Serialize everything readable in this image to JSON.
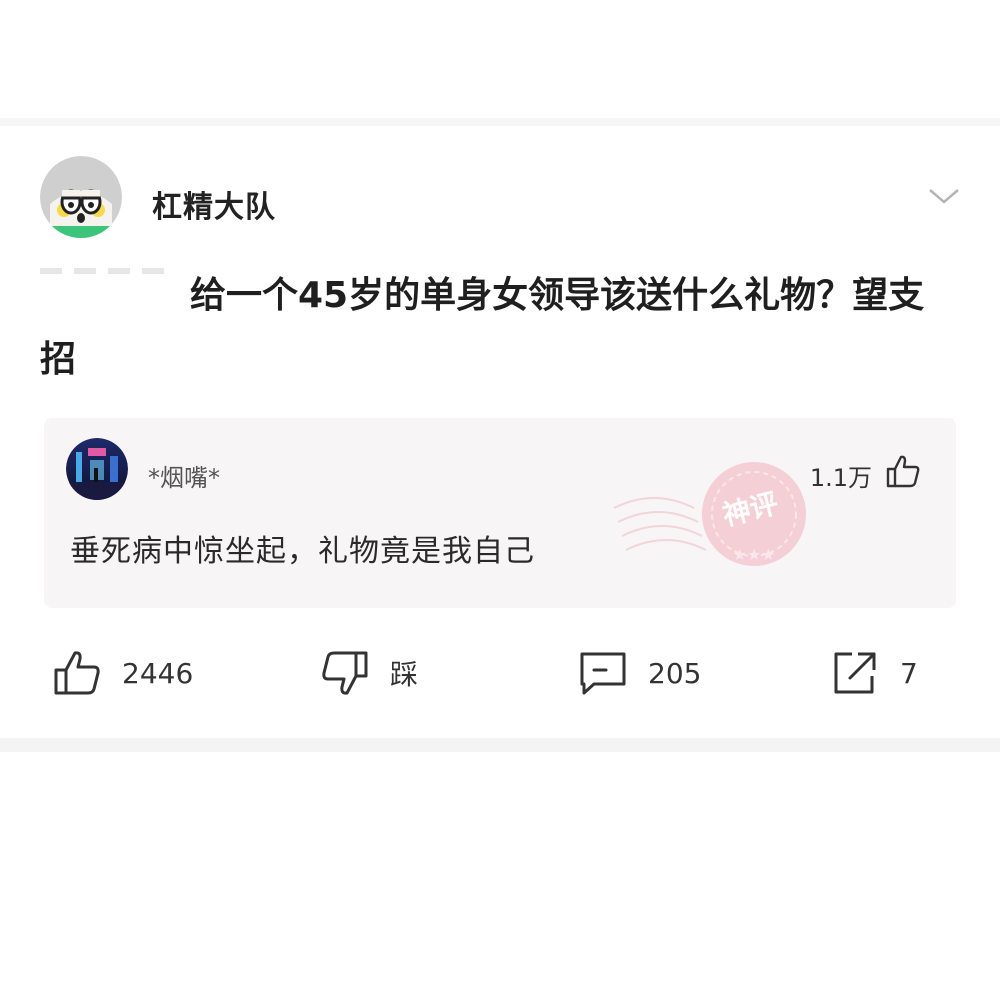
{
  "post": {
    "author": "杠精大队",
    "title": "给一个45岁的单身女领导该送什么礼物？望支招"
  },
  "hot_comment": {
    "author": "*烟嘴*",
    "likes": "1.1万",
    "text": "垂死病中惊坐起，礼物竟是我自己",
    "stamp_text": "神评"
  },
  "actions": {
    "like_count": "2446",
    "dislike_label": "踩",
    "comment_count": "205",
    "share_count": "7"
  },
  "icons": {
    "avatar": "cartoon-face-avatar",
    "more": "chevron-down-icon",
    "like": "thumbs-up-icon",
    "dislike": "thumbs-down-icon",
    "comment": "comment-bubble-icon",
    "share": "share-icon"
  },
  "colors": {
    "stamp": "#e87a8a",
    "comment_bg": "#f7f5f5"
  }
}
